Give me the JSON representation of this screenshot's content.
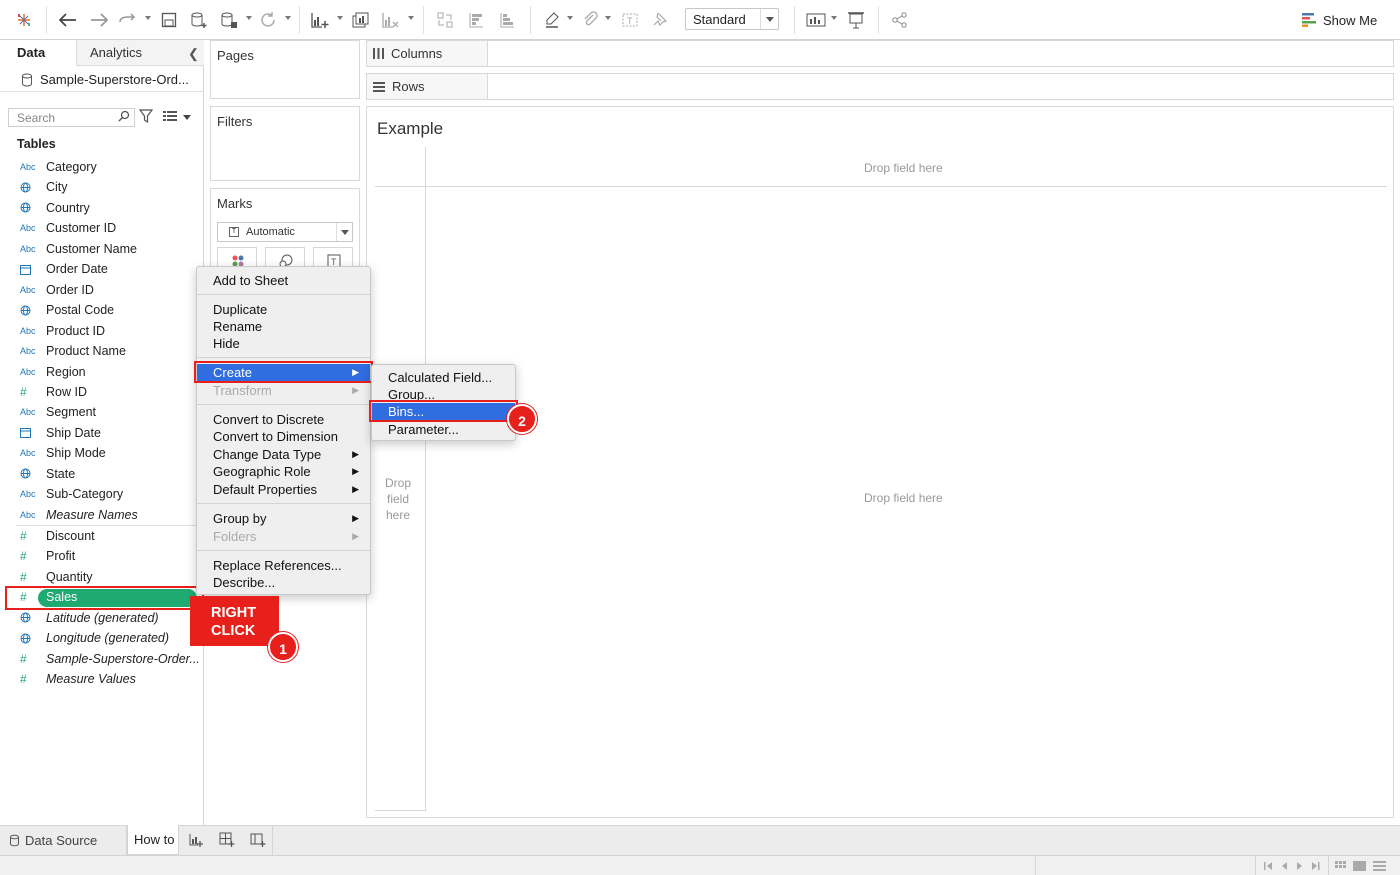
{
  "toolbar": {
    "fit_select": "Standard",
    "show_me_label": "Show Me"
  },
  "data_pane": {
    "tabs": [
      "Data",
      "Analytics"
    ],
    "datasource_name": "Sample-Superstore-Ord...",
    "search_placeholder": "Search",
    "tables_heading": "Tables",
    "dimensions": [
      {
        "name": "Category",
        "icon": "Abc"
      },
      {
        "name": "City",
        "icon": "globe"
      },
      {
        "name": "Country",
        "icon": "globe"
      },
      {
        "name": "Customer ID",
        "icon": "Abc"
      },
      {
        "name": "Customer Name",
        "icon": "Abc"
      },
      {
        "name": "Order Date",
        "icon": "calendar"
      },
      {
        "name": "Order ID",
        "icon": "Abc"
      },
      {
        "name": "Postal Code",
        "icon": "globe"
      },
      {
        "name": "Product ID",
        "icon": "Abc"
      },
      {
        "name": "Product Name",
        "icon": "Abc"
      },
      {
        "name": "Region",
        "icon": "Abc"
      },
      {
        "name": "Row ID",
        "icon": "hash"
      },
      {
        "name": "Segment",
        "icon": "Abc"
      },
      {
        "name": "Ship Date",
        "icon": "calendar"
      },
      {
        "name": "Ship Mode",
        "icon": "Abc"
      },
      {
        "name": "State",
        "icon": "globe"
      },
      {
        "name": "Sub-Category",
        "icon": "Abc"
      },
      {
        "name": "Measure Names",
        "icon": "Abc",
        "italic": true
      }
    ],
    "measures": [
      {
        "name": "Discount",
        "icon": "hash"
      },
      {
        "name": "Profit",
        "icon": "hash"
      },
      {
        "name": "Quantity",
        "icon": "hash"
      },
      {
        "name": "Sales",
        "icon": "hash",
        "selected": true
      },
      {
        "name": "Latitude (generated)",
        "icon": "globe",
        "italic": true
      },
      {
        "name": "Longitude (generated)",
        "icon": "globe",
        "italic": true
      },
      {
        "name": "Sample-Superstore-Order...",
        "icon": "hash",
        "italic": true
      },
      {
        "name": "Measure Values",
        "icon": "hash",
        "italic": true
      }
    ]
  },
  "cards": {
    "pages": "Pages",
    "filters": "Filters",
    "marks": "Marks",
    "mark_type": "Automatic"
  },
  "shelves": {
    "columns": "Columns",
    "rows": "Rows"
  },
  "canvas": {
    "sheet_title": "Example",
    "drop_hint": "Drop field here",
    "drop_hint_left": "Drop field here"
  },
  "context_menu": {
    "items": [
      {
        "label": "Add to Sheet"
      },
      {
        "label": "Duplicate"
      },
      {
        "label": "Rename"
      },
      {
        "label": "Hide"
      },
      {
        "label": "Create",
        "submenu": true,
        "highlighted": true
      },
      {
        "label": "Transform",
        "submenu": true,
        "disabled": true
      },
      {
        "label": "Convert to Discrete"
      },
      {
        "label": "Convert to Dimension"
      },
      {
        "label": "Change Data Type",
        "submenu": true
      },
      {
        "label": "Geographic Role",
        "submenu": true
      },
      {
        "label": "Default Properties",
        "submenu": true
      },
      {
        "label": "Group by",
        "submenu": true
      },
      {
        "label": "Folders",
        "submenu": true,
        "disabled": true
      },
      {
        "label": "Replace References..."
      },
      {
        "label": "Describe..."
      }
    ]
  },
  "submenu": {
    "items": [
      {
        "label": "Calculated Field..."
      },
      {
        "label": "Group..."
      },
      {
        "label": "Bins...",
        "highlighted": true
      },
      {
        "label": "Parameter..."
      }
    ]
  },
  "annotations": {
    "callout_line1": "RIGHT",
    "callout_line2": "CLICK",
    "step1": "1",
    "step2": "2",
    "accent_color": "#e8201c",
    "highlight_color": "#2f6de1",
    "measure_pill_color": "#1faa72"
  },
  "bottom_tabs": {
    "data_source": "Data Source",
    "sheet": "How to"
  }
}
